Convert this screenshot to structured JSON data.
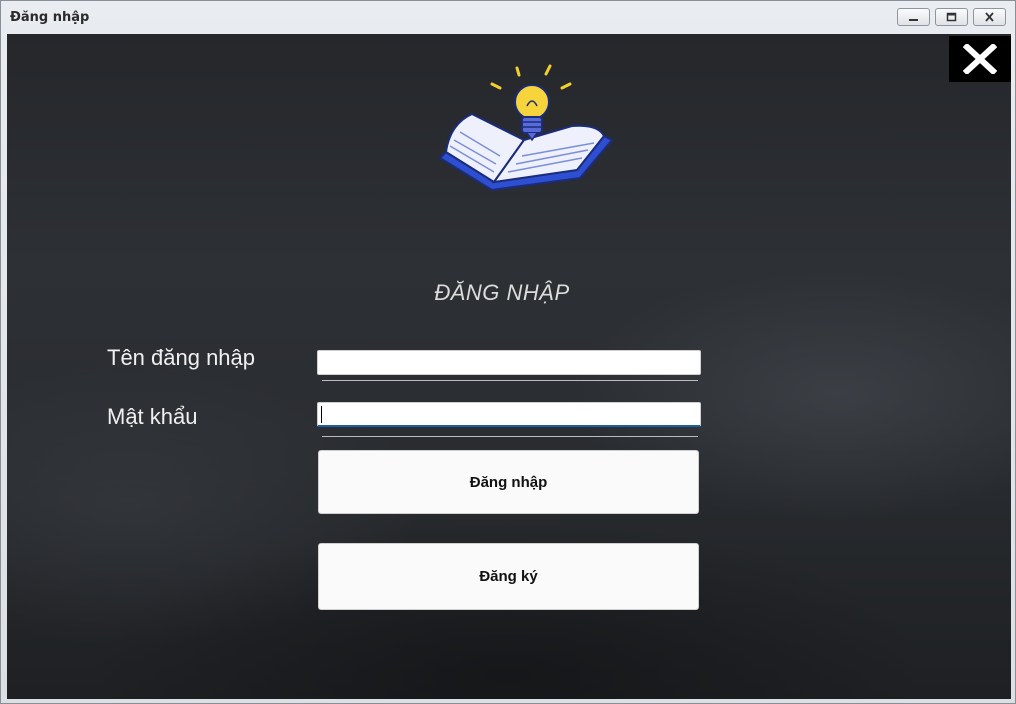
{
  "window": {
    "title": "Đăng nhập",
    "controls": [
      "minimize-icon",
      "maximize-icon",
      "close-icon"
    ]
  },
  "close_overlay": {
    "icon": "close-x-icon"
  },
  "logo": {
    "icon": "book-lightbulb-icon",
    "colors": {
      "book": "#3b5bd6",
      "bulb": "#f7d33c"
    }
  },
  "form": {
    "heading": "ĐĂNG NHẬP",
    "username_label": "Tên đăng nhập",
    "username_value": "",
    "password_label": "Mật khẩu",
    "password_value": "",
    "login_button": "Đăng nhập",
    "register_button": "Đăng ký"
  },
  "colors": {
    "background": "#2a2d31",
    "focus_accent": "#1f5f9e"
  }
}
